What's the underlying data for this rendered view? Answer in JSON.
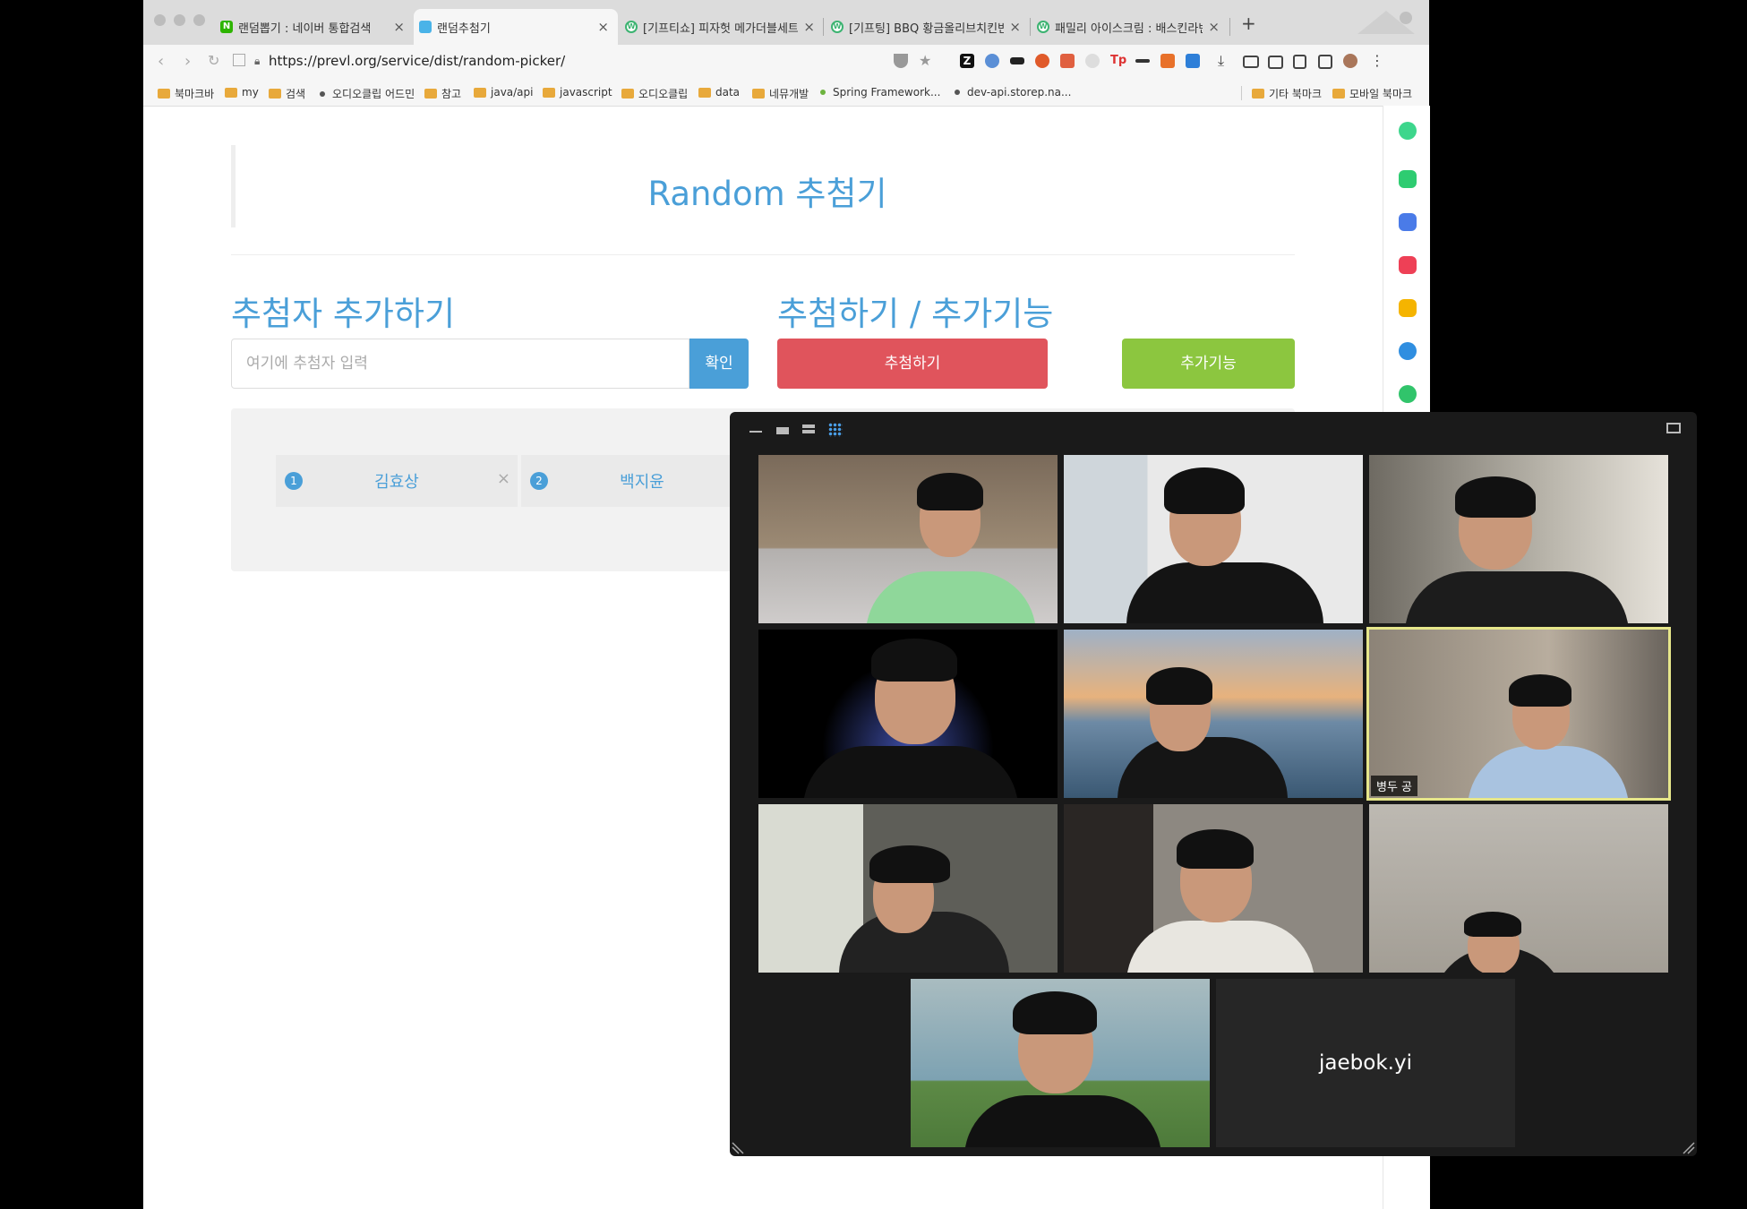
{
  "browser": {
    "tabs": [
      {
        "label": "랜덤뽑기 : 네이버 통합검색",
        "icon": "naver-icon"
      },
      {
        "label": "랜덤추첨기",
        "icon": "random-picker-icon"
      },
      {
        "label": "[기프티쇼] 피자헛 메가더블세트...",
        "icon": "giftishow-icon"
      },
      {
        "label": "[기프팅] BBQ 황금올리브치킨반...",
        "icon": "gifting-icon"
      },
      {
        "label": "패밀리 아이스크림 : 배스킨라빈스...",
        "icon": "baskin-icon"
      }
    ],
    "url": "https://prevl.org/service/dist/random-picker/",
    "bookmarks": [
      {
        "label": "북마크바",
        "type": "folder"
      },
      {
        "label": "my",
        "type": "folder"
      },
      {
        "label": "검색",
        "type": "folder"
      },
      {
        "label": "오디오클립 어드민",
        "type": "link"
      },
      {
        "label": "참고",
        "type": "folder"
      },
      {
        "label": "java/api",
        "type": "folder"
      },
      {
        "label": "javascript",
        "type": "folder"
      },
      {
        "label": "오디오클립",
        "type": "folder"
      },
      {
        "label": "data",
        "type": "folder"
      },
      {
        "label": "네뮤개발",
        "type": "folder"
      },
      {
        "label": "Spring Framework...",
        "type": "link"
      },
      {
        "label": "dev-api.storep.na...",
        "type": "link"
      }
    ],
    "bookmarks_right": [
      "기타 북마크",
      "모바일 북마크"
    ]
  },
  "page": {
    "title": "Random 추첨기",
    "add_section_title": "추첨자 추가하기",
    "draw_section_title": "추첨하기 / 추가기능",
    "input_placeholder": "여기에 추첨자 입력",
    "confirm_label": "확인",
    "draw_label": "추첨하기",
    "extra_label": "추가기능",
    "participants": [
      {
        "num": "1",
        "name": "김효상"
      },
      {
        "num": "2",
        "name": "백지윤"
      }
    ]
  },
  "zoom": {
    "tiles": [
      {
        "label": ""
      },
      {
        "label": ""
      },
      {
        "label": ""
      },
      {
        "label": ""
      },
      {
        "label": ""
      },
      {
        "label": "병두 공",
        "active": true
      },
      {
        "label": ""
      },
      {
        "label": ""
      },
      {
        "label": ""
      },
      {
        "label": ""
      },
      {
        "label": "jaebok.yi",
        "video": false
      }
    ]
  },
  "colors": {
    "accent": "#4a9fd8",
    "draw_button": "#e0545c",
    "extra_button": "#8cc63f",
    "active_speaker": "#e6e68a"
  }
}
